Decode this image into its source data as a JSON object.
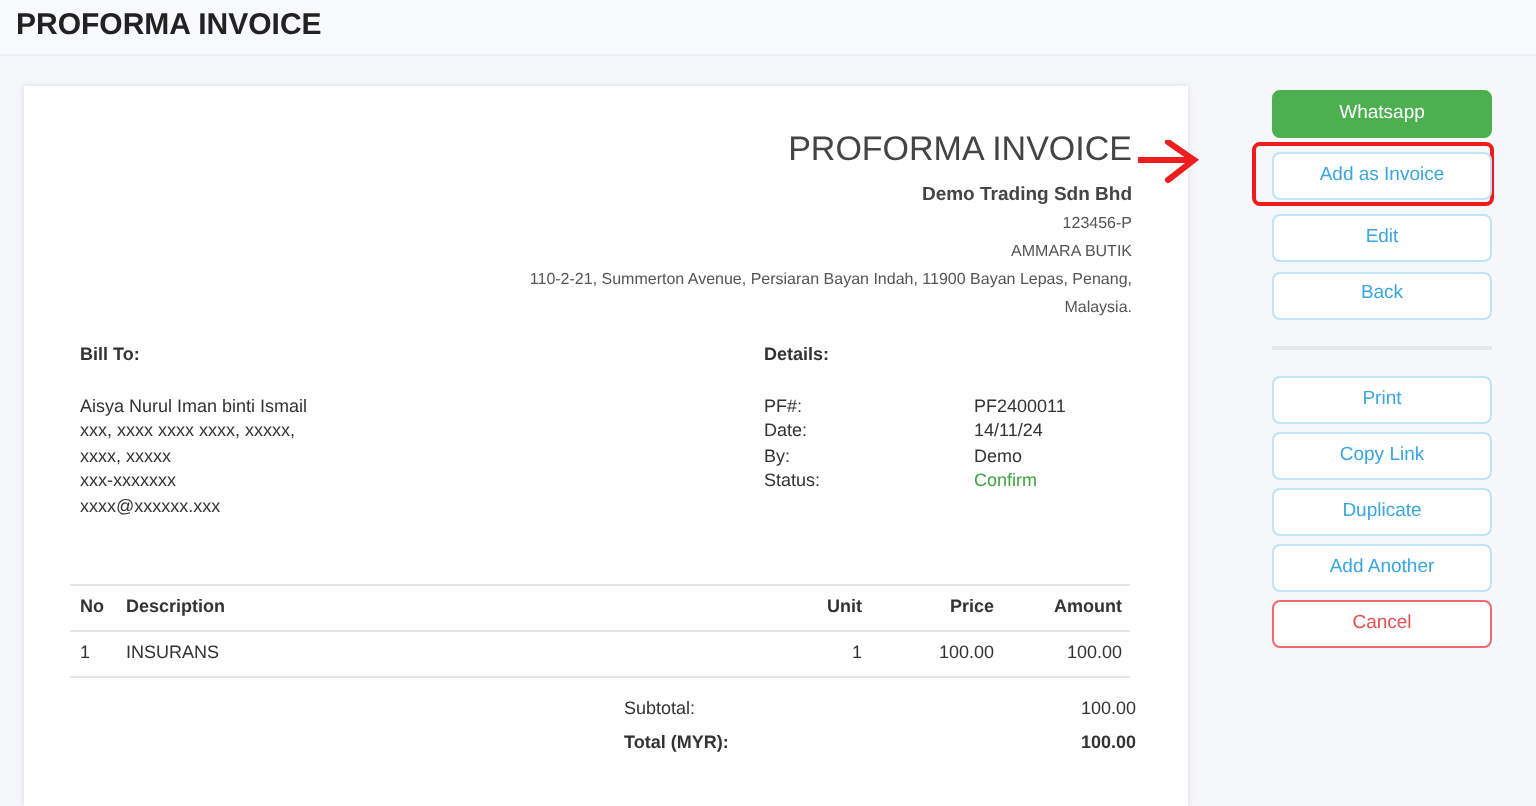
{
  "header": {
    "title": "PROFORMA INVOICE"
  },
  "invoice": {
    "title": "PROFORMA INVOICE",
    "company": {
      "name": "Demo Trading Sdn Bhd",
      "lines": [
        "123456-P",
        "AMMARA BUTIK",
        "110-2-21, Summerton Avenue, Persiaran Bayan Indah, 11900 Bayan Lepas, Penang,",
        "Malaysia."
      ]
    },
    "bill_to": {
      "heading": "Bill To:",
      "lines": [
        "Aisya Nurul Iman binti Ismail",
        "xxx, xxxx xxxx xxxx, xxxxx,",
        "xxxx, xxxxx",
        "xxx-xxxxxxx",
        "xxxx@xxxxxx.xxx"
      ]
    },
    "details": {
      "heading": "Details:",
      "rows": [
        {
          "label": "PF#:",
          "value": "PF2400011",
          "kind": "plain"
        },
        {
          "label": "Date:",
          "value": "14/11/24",
          "kind": "plain"
        },
        {
          "label": "By:",
          "value": "Demo",
          "kind": "plain"
        },
        {
          "label": "Status:",
          "value": "Confirm",
          "kind": "status"
        }
      ]
    },
    "table": {
      "columns": [
        "No",
        "Description",
        "Unit",
        "Price",
        "Amount"
      ],
      "rows": [
        [
          "1",
          "INSURANS",
          "1",
          "100.00",
          "100.00"
        ]
      ]
    },
    "totals": [
      {
        "label": "Subtotal:",
        "value": "100.00",
        "kind": "plain"
      },
      {
        "label": "Total (MYR):",
        "value": "100.00",
        "kind": "grand"
      }
    ]
  },
  "actions": [
    [
      {
        "label": "Whatsapp",
        "kind": "primary",
        "highlighted": false
      },
      {
        "label": "Add as Invoice",
        "kind": "outline",
        "highlighted": true
      },
      {
        "label": "Edit",
        "kind": "outline",
        "highlighted": false
      },
      {
        "label": "Back",
        "kind": "outline",
        "highlighted": false
      }
    ],
    [
      {
        "label": "Print",
        "kind": "outline",
        "highlighted": false
      },
      {
        "label": "Copy Link",
        "kind": "outline",
        "highlighted": false
      },
      {
        "label": "Duplicate",
        "kind": "outline",
        "highlighted": false
      },
      {
        "label": "Add Another",
        "kind": "outline",
        "highlighted": false
      },
      {
        "label": "Cancel",
        "kind": "danger",
        "highlighted": false
      }
    ]
  ]
}
